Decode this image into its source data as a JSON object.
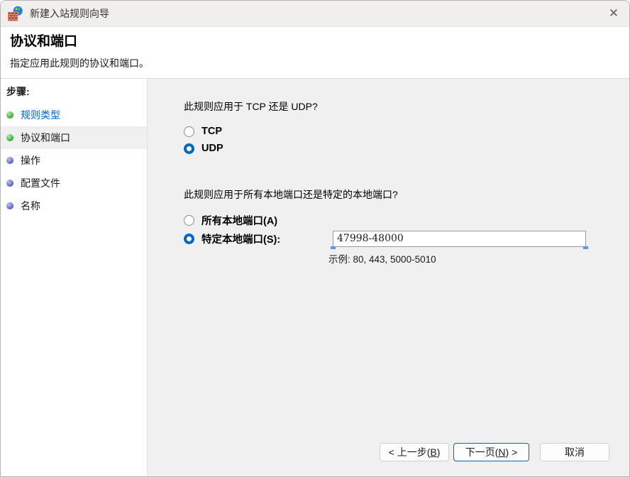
{
  "window": {
    "title": "新建入站规则向导",
    "close_glyph": "✕"
  },
  "header": {
    "title": "协议和端口",
    "subtitle": "指定应用此规则的协议和端口。"
  },
  "sidebar": {
    "heading": "步骤:",
    "items": [
      {
        "label": "规则类型",
        "state": "completed-link",
        "selected": false
      },
      {
        "label": "协议和端口",
        "state": "current",
        "selected": true
      },
      {
        "label": "操作",
        "state": "upcoming",
        "selected": false
      },
      {
        "label": "配置文件",
        "state": "upcoming",
        "selected": false
      },
      {
        "label": "名称",
        "state": "upcoming",
        "selected": false
      }
    ]
  },
  "main": {
    "protocol_question": "此规则应用于 TCP 还是 UDP?",
    "protocol_options": [
      {
        "label": "TCP",
        "selected": false
      },
      {
        "label": "UDP",
        "selected": true
      }
    ],
    "ports_question": "此规则应用于所有本地端口还是特定的本地端口?",
    "ports_options": [
      {
        "label": "所有本地端口(A)",
        "selected": false
      },
      {
        "label": "特定本地端口(S):",
        "selected": true
      }
    ],
    "port_input": {
      "value": "47998-48000"
    },
    "port_example": "示例: 80, 443, 5000-5010"
  },
  "footer": {
    "back": {
      "pre": "< 上一步(",
      "mnemonic": "B",
      "post": ")"
    },
    "next": {
      "pre": "下一页(",
      "mnemonic": "N",
      "post": ") >"
    },
    "cancel": "取消"
  },
  "colors": {
    "accent": "#0067c0",
    "link": "#0066cc",
    "completed_bullet": "#3aa33a",
    "upcoming_bullet": "#5a60bb",
    "main_background": "#f0f0f0"
  }
}
